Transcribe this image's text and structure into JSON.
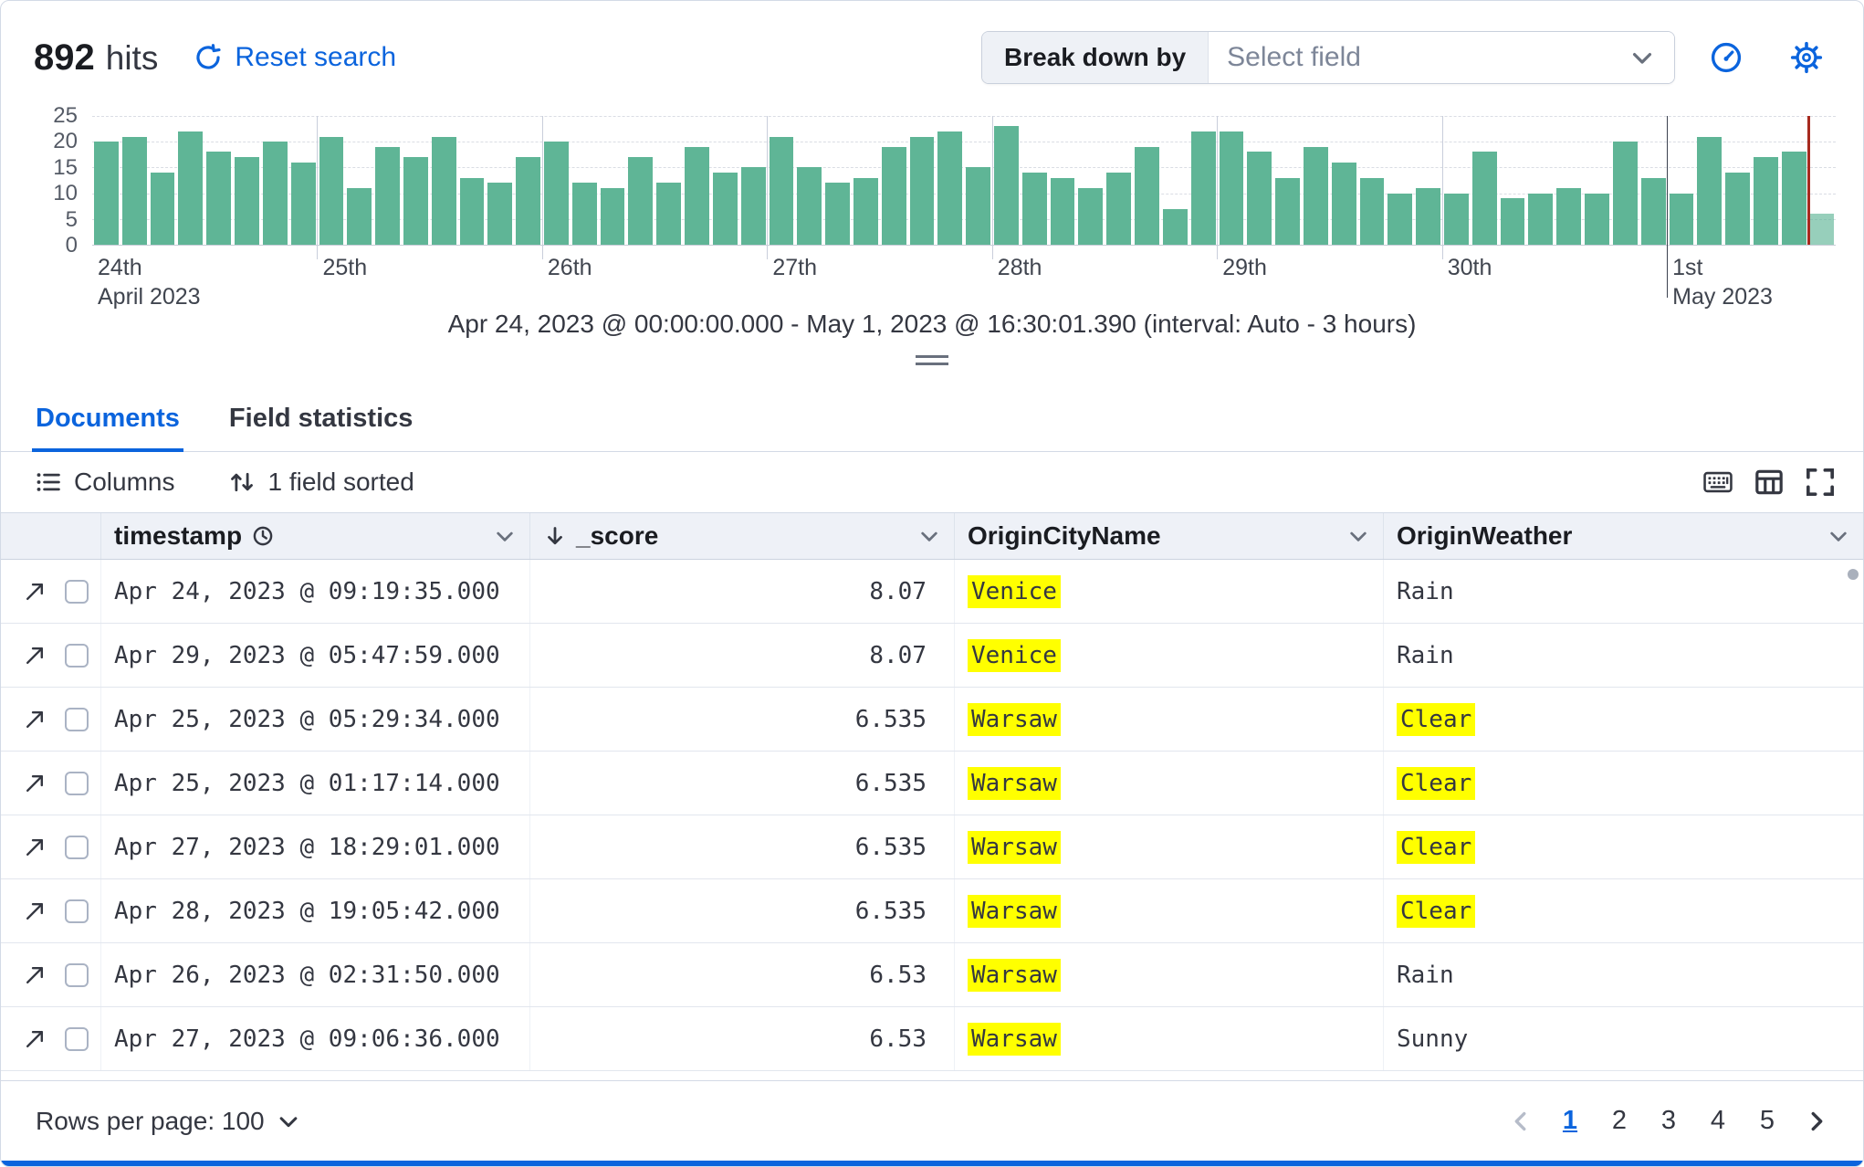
{
  "colors": {
    "accent": "#0B64DD",
    "bar_green": "#5FB596",
    "highlight_yellow": "#FFFF00",
    "time_marker_red": "#A62A1E"
  },
  "header": {
    "hits_count": "892",
    "hits_label": "hits",
    "reset_search_label": "Reset search",
    "break_down_by_label": "Break down by",
    "select_field_placeholder": "Select field"
  },
  "chart_data": {
    "type": "bar",
    "title": "Document count histogram",
    "ylim": [
      0,
      25
    ],
    "y_ticks": [
      25,
      20,
      15,
      10,
      5,
      0
    ],
    "interval": "Auto - 3 hours",
    "bucket_count": 62,
    "partial_last_bucket": true,
    "values": [
      20,
      21,
      14,
      22,
      18,
      17,
      20,
      16,
      21,
      11,
      19,
      17,
      21,
      13,
      12,
      17,
      20,
      12,
      11,
      17,
      12,
      19,
      14,
      15,
      21,
      15,
      12,
      13,
      19,
      21,
      22,
      15,
      23,
      14,
      13,
      11,
      14,
      19,
      7,
      22,
      22,
      18,
      13,
      19,
      16,
      13,
      10,
      11,
      10,
      18,
      9,
      10,
      11,
      10,
      20,
      13,
      10,
      21,
      14,
      17,
      18,
      6
    ],
    "x_day_ticks": [
      {
        "index": 0,
        "line1": "24th",
        "line2": "April 2023",
        "emphasized": false
      },
      {
        "index": 8,
        "line1": "25th",
        "line2": "",
        "emphasized": false
      },
      {
        "index": 16,
        "line1": "26th",
        "line2": "",
        "emphasized": false
      },
      {
        "index": 24,
        "line1": "27th",
        "line2": "",
        "emphasized": false
      },
      {
        "index": 32,
        "line1": "28th",
        "line2": "",
        "emphasized": false
      },
      {
        "index": 40,
        "line1": "29th",
        "line2": "",
        "emphasized": false
      },
      {
        "index": 48,
        "line1": "30th",
        "line2": "",
        "emphasized": false
      },
      {
        "index": 56,
        "line1": "1st",
        "line2": "May 2023",
        "emphasized": true
      }
    ]
  },
  "chart_caption": "Apr 24, 2023 @ 00:00:00.000 - May 1, 2023 @ 16:30:01.390 (interval: Auto - 3 hours)",
  "tabs": [
    {
      "label": "Documents",
      "active": true
    },
    {
      "label": "Field statistics",
      "active": false
    }
  ],
  "toolbar": {
    "columns_label": "Columns",
    "sort_label": "1 field sorted"
  },
  "table": {
    "columns": [
      {
        "id": "timestamp",
        "label": "timestamp",
        "icon": "clock"
      },
      {
        "id": "_score",
        "label": "_score",
        "sorted": "desc"
      },
      {
        "id": "OriginCityName",
        "label": "OriginCityName"
      },
      {
        "id": "OriginWeather",
        "label": "OriginWeather"
      }
    ],
    "rows": [
      {
        "timestamp": "Apr 24, 2023 @ 09:19:35.000",
        "score": "8.07",
        "city": "Venice",
        "city_highlight": true,
        "weather": "Rain",
        "weather_highlight": false
      },
      {
        "timestamp": "Apr 29, 2023 @ 05:47:59.000",
        "score": "8.07",
        "city": "Venice",
        "city_highlight": true,
        "weather": "Rain",
        "weather_highlight": false
      },
      {
        "timestamp": "Apr 25, 2023 @ 05:29:34.000",
        "score": "6.535",
        "city": "Warsaw",
        "city_highlight": true,
        "weather": "Clear",
        "weather_highlight": true
      },
      {
        "timestamp": "Apr 25, 2023 @ 01:17:14.000",
        "score": "6.535",
        "city": "Warsaw",
        "city_highlight": true,
        "weather": "Clear",
        "weather_highlight": true
      },
      {
        "timestamp": "Apr 27, 2023 @ 18:29:01.000",
        "score": "6.535",
        "city": "Warsaw",
        "city_highlight": true,
        "weather": "Clear",
        "weather_highlight": true
      },
      {
        "timestamp": "Apr 28, 2023 @ 19:05:42.000",
        "score": "6.535",
        "city": "Warsaw",
        "city_highlight": true,
        "weather": "Clear",
        "weather_highlight": true
      },
      {
        "timestamp": "Apr 26, 2023 @ 02:31:50.000",
        "score": "6.53",
        "city": "Warsaw",
        "city_highlight": true,
        "weather": "Rain",
        "weather_highlight": false
      },
      {
        "timestamp": "Apr 27, 2023 @ 09:06:36.000",
        "score": "6.53",
        "city": "Warsaw",
        "city_highlight": true,
        "weather": "Sunny",
        "weather_highlight": false
      }
    ]
  },
  "footer": {
    "rows_per_page_label": "Rows per page: 100",
    "pages": [
      "1",
      "2",
      "3",
      "4",
      "5"
    ],
    "active_page": "1"
  }
}
